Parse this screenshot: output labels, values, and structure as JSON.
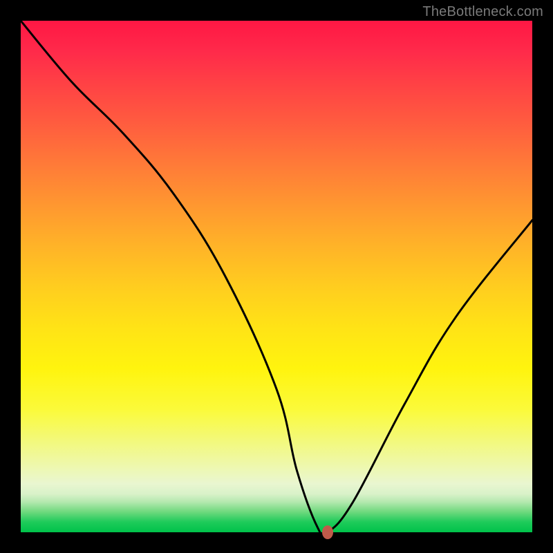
{
  "watermark": "TheBottleneck.com",
  "chart_data": {
    "type": "line",
    "title": "",
    "xlabel": "",
    "ylabel": "",
    "xlim": [
      0,
      100
    ],
    "ylim": [
      0,
      100
    ],
    "grid": false,
    "series": [
      {
        "name": "curve",
        "x": [
          0,
          10,
          20,
          30,
          40,
          50,
          54,
          58,
          60,
          65,
          75,
          85,
          100
        ],
        "values": [
          100,
          88,
          78,
          66,
          50,
          28,
          12,
          1,
          0,
          6,
          25,
          42,
          61
        ]
      }
    ],
    "marker": {
      "x": 60,
      "y": 0,
      "color": "#c05a4a"
    },
    "gradient_stops": [
      {
        "pos": 0,
        "color": "#ff1744"
      },
      {
        "pos": 50,
        "color": "#ffcd1f"
      },
      {
        "pos": 90,
        "color": "#eef8ad"
      },
      {
        "pos": 100,
        "color": "#00c24a"
      }
    ]
  }
}
